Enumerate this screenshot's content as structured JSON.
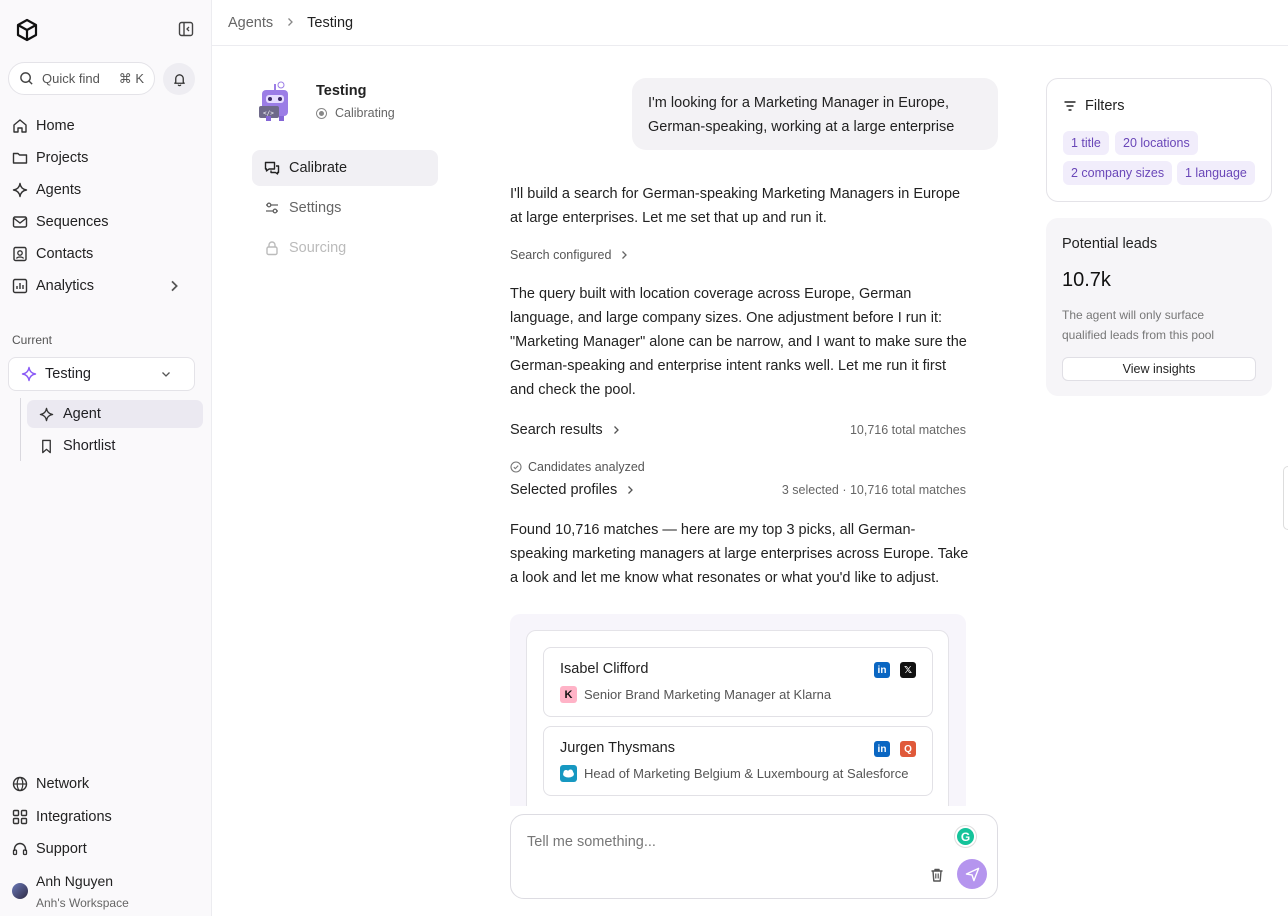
{
  "breadcrumb": {
    "parent": "Agents",
    "current": "Testing"
  },
  "sidebar": {
    "search_label": "Quick find",
    "search_shortcut": "⌘ K",
    "nav": [
      {
        "label": "Home",
        "icon": "home-icon"
      },
      {
        "label": "Projects",
        "icon": "folder-icon"
      },
      {
        "label": "Agents",
        "icon": "sparkle-icon"
      },
      {
        "label": "Sequences",
        "icon": "mail-icon"
      },
      {
        "label": "Contacts",
        "icon": "contacts-icon"
      },
      {
        "label": "Analytics",
        "icon": "chart-icon"
      }
    ],
    "section_label": "Current",
    "current_selector": "Testing",
    "sub_items": [
      {
        "label": "Agent",
        "icon": "sparkle-icon",
        "active": true
      },
      {
        "label": "Shortlist",
        "icon": "bookmark-icon",
        "active": false
      }
    ],
    "bottom": [
      {
        "label": "Network",
        "icon": "globe-icon"
      },
      {
        "label": "Integrations",
        "icon": "grid-icon"
      },
      {
        "label": "Support",
        "icon": "headset-icon"
      }
    ],
    "user": {
      "name": "Anh Nguyen",
      "workspace": "Anh's Workspace"
    }
  },
  "agent": {
    "name": "Testing",
    "status": "Calibrating",
    "menu": [
      {
        "label": "Calibrate",
        "icon": "chat-icon",
        "active": true
      },
      {
        "label": "Settings",
        "icon": "sliders-icon",
        "active": false
      },
      {
        "label": "Sourcing",
        "icon": "lock-icon",
        "active": false
      }
    ]
  },
  "chat": {
    "user_message": "I'm looking for a Marketing Manager in Europe, German-speaking, working at a large enterprise",
    "reply_1": "I'll build a search for German-speaking Marketing Managers in Europe at large enterprises. Let me set that up and run it.",
    "step_configured": "Search configured",
    "reply_2": "The query built with location coverage across Europe, German language, and large company sizes. One adjustment before I run it: \"Marketing Manager\" alone can be narrow, and I want to make sure the German-speaking and enterprise intent ranks well. Let me run it first and check the pool.",
    "search_results": {
      "label": "Search results",
      "meta": "10,716 total matches"
    },
    "candidates_step": "Candidates analyzed",
    "selected_profiles": {
      "label": "Selected profiles",
      "meta": "3 selected · 10,716 total matches"
    },
    "reply_3": "Found 10,716 matches — here are my top 3 picks, all German-speaking marketing managers at large enterprises across Europe. Take a look and let me know what resonates or what you'd like to adjust.",
    "profiles": [
      {
        "name": "Isabel Clifford",
        "role": "Senior Brand Marketing Manager at Klarna",
        "company_logo": "K",
        "socials": [
          "linkedin-icon",
          "x-icon"
        ]
      },
      {
        "name": "Jurgen Thysmans",
        "role": "Head of Marketing Belgium & Luxembourg at Salesforce",
        "company_logo": "salesforce-logo",
        "socials": [
          "linkedin-icon",
          "q-icon"
        ]
      }
    ],
    "input_placeholder": "Tell me something..."
  },
  "filters": {
    "title": "Filters",
    "chips": [
      "1 title",
      "20 locations",
      "2 company sizes",
      "1 language"
    ]
  },
  "leads": {
    "title": "Potential leads",
    "value": "10.7k",
    "description": "The agent will only surface qualified leads from this pool",
    "button": "View insights"
  },
  "colors": {
    "accent": "#8b5cf6",
    "chip_bg": "#f1edfb",
    "chip_text": "#6a47b8",
    "send": "#b595ee"
  }
}
